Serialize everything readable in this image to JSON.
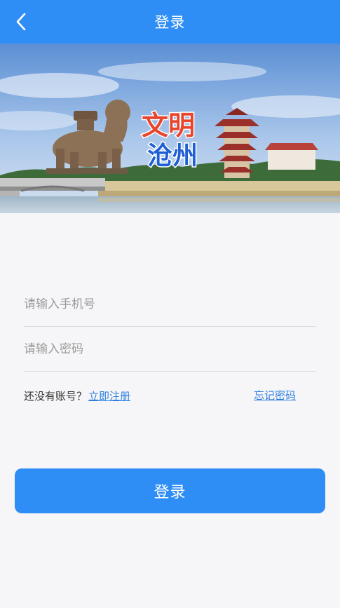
{
  "header": {
    "title": "登录",
    "back_icon": "chevron-left-icon"
  },
  "banner": {
    "logo_line1": "文明",
    "logo_line2": "沧州"
  },
  "form": {
    "phone_placeholder": "请输入手机号",
    "password_placeholder": "请输入密码",
    "no_account_text": "还没有账号？",
    "register_link": "立即注册",
    "forgot_password_link": "忘记密码",
    "login_button": "登录"
  },
  "colors": {
    "primary": "#2f8ef6",
    "link": "#2f7fe0",
    "logo_red": "#e8452c",
    "logo_blue": "#1f5fd6"
  }
}
